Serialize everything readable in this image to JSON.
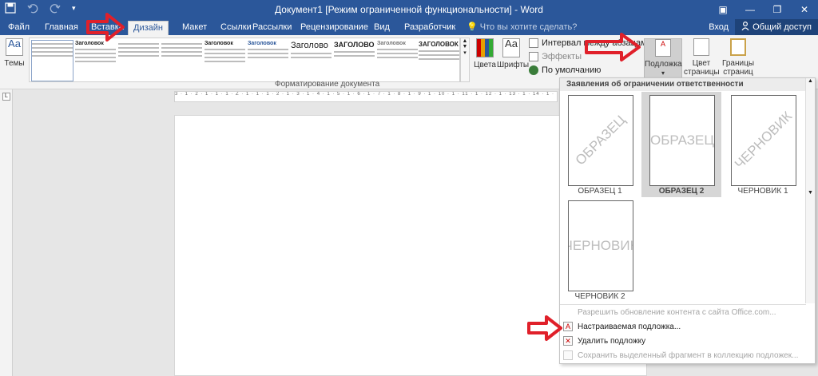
{
  "titlebar": {
    "title": "Документ1 [Режим ограниченной функциональности] - Word",
    "save_icon": "save-icon",
    "undo_icon": "undo-icon",
    "redo_icon": "redo-icon",
    "window_icons": [
      "ribbon-display-icon",
      "minimize-icon",
      "restore-icon",
      "close-icon"
    ]
  },
  "tabs": [
    {
      "label": "Файл",
      "active": false
    },
    {
      "label": "Главная",
      "active": false
    },
    {
      "label": "Вставка",
      "active": false
    },
    {
      "label": "Дизайн",
      "active": true
    },
    {
      "label": "Макет",
      "active": false
    },
    {
      "label": "Ссылки",
      "active": false
    },
    {
      "label": "Рассылки",
      "active": false
    },
    {
      "label": "Рецензирование",
      "active": false
    },
    {
      "label": "Вид",
      "active": false
    },
    {
      "label": "Разработчик",
      "active": false
    }
  ],
  "tellme": "Что вы хотите сделать?",
  "signin": "Вход",
  "share": "Общий доступ",
  "ribbon": {
    "themes_label": "Темы",
    "gallery_headings": [
      "",
      "Заголовок",
      "",
      "",
      "Заголовок",
      "Заголовок",
      "Заголово",
      "ЗАГОЛОВО",
      "Заголовок",
      "ЗАГОЛОВОК"
    ],
    "colors_label": "Цвета",
    "fonts_label": "Шрифты",
    "spacing_label": "Интервал между абзацами",
    "effects_label": "Эффекты",
    "default_label": "По умолчанию",
    "watermark_label": "Подложка",
    "page_color_label": "Цвет страницы",
    "page_borders_label": "Границы страниц",
    "group_label": "Форматирование документа"
  },
  "ruler_text": "3 · 1 · 2 · 1 · 1 · 1 · Z · 1 · 1 · 1 · 2 · 1 · 3 · 1 · 4 · 1 · 5 · 1 · 6 · 1 · 7 · 1 · 8 · 1 · 9 · 1 · 10 · 1 · 11 · 1 · 12 · 1 · 13 · 1 · 14 · 1 · 15",
  "dropdown": {
    "heading": "Заявления об ограничении ответственности",
    "items": [
      {
        "label": "ОБРАЗЕЦ 1",
        "text": "ОБРАЗЕЦ",
        "selected": false
      },
      {
        "label": "ОБРАЗЕЦ 2",
        "text": "ОБРАЗЕЦ",
        "selected": true
      },
      {
        "label": "ЧЕРНОВИК 1",
        "text": "ЧЕРНОВИК",
        "selected": false
      },
      {
        "label": "ЧЕРНОВИК 2",
        "text": "ЧЕРНОВИК",
        "selected": false
      }
    ],
    "menu": [
      {
        "label": "Разрешить обновление контента с сайта Office.com...",
        "disabled": true,
        "icon": "none"
      },
      {
        "label": "Настраиваемая подложка...",
        "disabled": false,
        "icon": "custom-watermark-icon"
      },
      {
        "label": "Удалить подложку",
        "disabled": false,
        "icon": "remove-watermark-icon"
      },
      {
        "label": "Сохранить выделенный фрагмент в коллекцию подложек...",
        "disabled": true,
        "icon": "save-watermark-icon"
      }
    ]
  },
  "colors": {
    "title_blue": "#2b579a",
    "arrow_red": "#e0202a"
  }
}
